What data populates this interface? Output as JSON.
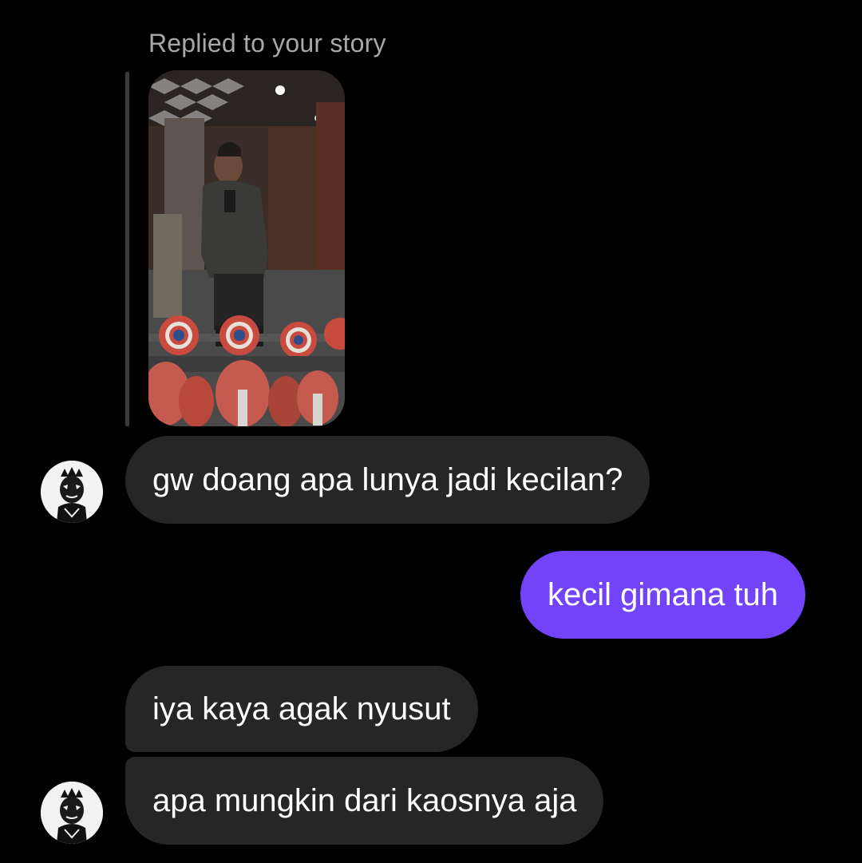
{
  "story_reply": {
    "label": "Replied to your story"
  },
  "messages": [
    {
      "sender": "them",
      "text": "gw doang apa lunya jadi kecilan?"
    },
    {
      "sender": "me",
      "text": "kecil gimana tuh"
    },
    {
      "sender": "them",
      "text": "iya kaya agak nyusut"
    },
    {
      "sender": "them",
      "text": "apa mungkin dari kaosnya aja"
    }
  ],
  "colors": {
    "background": "#000000",
    "incoming_bubble": "#262626",
    "outgoing_bubble": "#7343f9",
    "muted_text": "#a8a8a8"
  }
}
